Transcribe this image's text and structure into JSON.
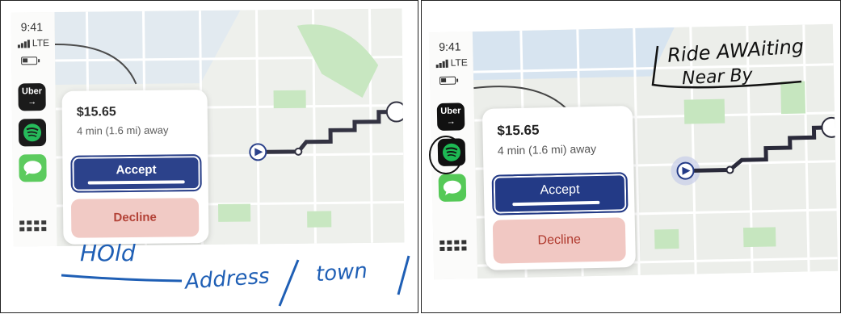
{
  "left": {
    "status": {
      "time": "9:41",
      "network": "LTE"
    },
    "apps": [
      {
        "name": "Uber",
        "label": "Uber",
        "sublabel": "→"
      },
      {
        "name": "Spotify"
      },
      {
        "name": "Messages"
      }
    ],
    "request": {
      "price": "$15.65",
      "eta": "4 min (1.6 mi) away"
    },
    "accept_label": "Accept",
    "decline_label": "Decline",
    "annotation": {
      "hold": "HOld",
      "address": "Address",
      "town": "town"
    }
  },
  "right": {
    "status": {
      "time": "9:41",
      "network": "LTE"
    },
    "apps": [
      {
        "name": "Uber",
        "label": "Uber",
        "sublabel": "→"
      },
      {
        "name": "Spotify"
      },
      {
        "name": "Messages"
      }
    ],
    "request": {
      "price": "$15.65",
      "eta": "4 min (1.6 mi) away"
    },
    "accept_label": "Accept",
    "decline_label": "Decline",
    "annotation": {
      "line1": "Ride AWAiting",
      "line2": "Near By"
    }
  },
  "colors": {
    "accept": "#233a86",
    "decline_bg": "#f1c8c3",
    "decline_text": "#b03a2e",
    "route": "#2a2a3a",
    "annotation_ink": "#1f5fb5",
    "map_green": "#c6e6bf",
    "water": "#cfe0f2"
  }
}
